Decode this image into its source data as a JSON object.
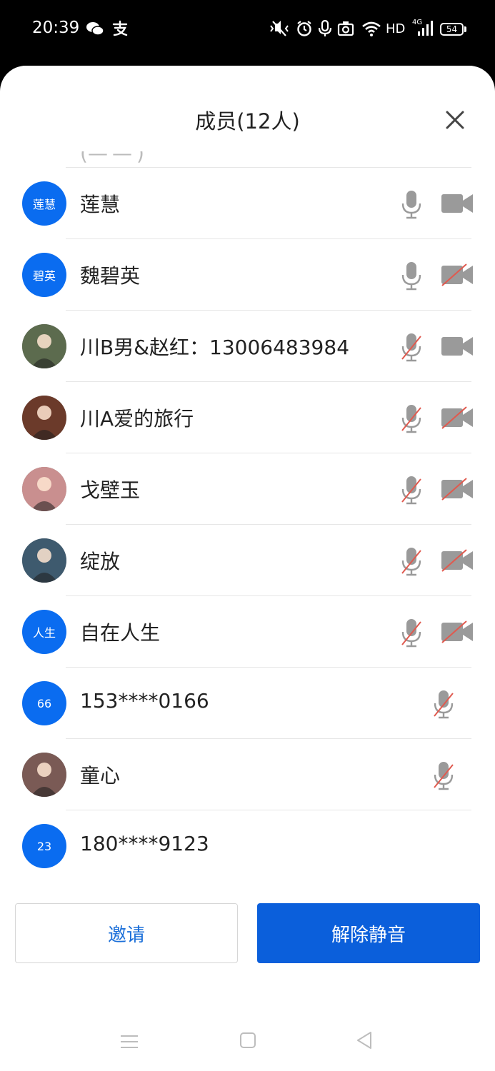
{
  "status_bar": {
    "time": "20:39",
    "network": "HD",
    "network_type": "4G",
    "battery": "54",
    "icons": [
      "wechat-icon",
      "alipay-icon",
      "vibrate-icon",
      "alarm-icon",
      "mic-icon",
      "camera-icon",
      "wifi-icon",
      "signal-icon",
      "battery-icon"
    ]
  },
  "sheet": {
    "title": "成员(12人)"
  },
  "members": [
    {
      "name": "莲慧",
      "avatar_text": "莲慧",
      "avatar_type": "text",
      "mic": "on",
      "cam": "on"
    },
    {
      "name": "魏碧英",
      "avatar_text": "碧英",
      "avatar_type": "text",
      "mic": "on",
      "cam": "off"
    },
    {
      "name": "川B男&赵红：13006483984",
      "avatar_text": "",
      "avatar_type": "photo",
      "mic": "off",
      "cam": "on"
    },
    {
      "name": "川A爱的旅行",
      "avatar_text": "",
      "avatar_type": "photo",
      "mic": "off",
      "cam": "off"
    },
    {
      "name": "戈壁玉",
      "avatar_text": "",
      "avatar_type": "photo",
      "mic": "off",
      "cam": "off"
    },
    {
      "name": "绽放",
      "avatar_text": "",
      "avatar_type": "photo",
      "mic": "off",
      "cam": "off"
    },
    {
      "name": "自在人生",
      "avatar_text": "人生",
      "avatar_type": "text",
      "mic": "off",
      "cam": "off"
    },
    {
      "name": "153****0166",
      "avatar_text": "66",
      "avatar_type": "text",
      "mic": "off",
      "cam": "none"
    },
    {
      "name": "童心",
      "avatar_text": "",
      "avatar_type": "photo",
      "mic": "off",
      "cam": "none"
    },
    {
      "name": "180****9123",
      "avatar_text": "23",
      "avatar_type": "text",
      "mic": "none",
      "cam": "none"
    }
  ],
  "buttons": {
    "invite": "邀请",
    "unmute": "解除静音"
  },
  "colors": {
    "accent": "#0b5fdb",
    "avatar_bg": "#0a6cf0",
    "icon_gray": "#9a9a9a",
    "muted_slash": "#e05a4f"
  }
}
